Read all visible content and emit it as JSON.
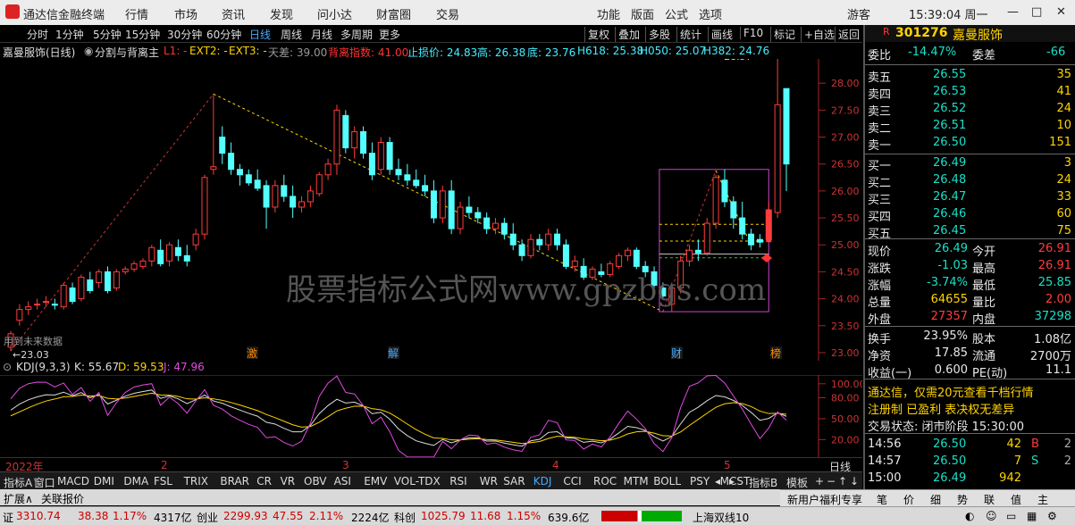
{
  "app": {
    "title": "通达信金融终端"
  },
  "menu": [
    "行情",
    "市场",
    "资讯",
    "发现",
    "问小达",
    "财富圈",
    "交易"
  ],
  "top_right": {
    "items": [
      "功能",
      "版面",
      "公式",
      "选项"
    ],
    "user": "游客",
    "time": "15:39:04 周一"
  },
  "toolbar": {
    "periods": [
      "分时",
      "1分钟",
      "5分钟",
      "15分钟",
      "30分钟",
      "60分钟",
      "日线",
      "周线",
      "月线",
      "多周期",
      "更多"
    ],
    "active_period": "日线",
    "buttons": [
      "复权",
      "叠加",
      "多股",
      "统计",
      "画线",
      "F10",
      "标记",
      "+自选",
      "返回"
    ]
  },
  "info": {
    "stock": "嘉曼服饰(日线)",
    "formula": "分割与背离主",
    "L1": "L1: -",
    "EXT2": "EXT2: -",
    "EXT3": "EXT3: -",
    "tiancha": "天差: 39.00",
    "beili": "背离指数: 41.00",
    "stop": "止损价: 24.83",
    "high": "高: 26.38",
    "low": "底: 23.76",
    "h618": "H618: 25.38",
    "h050": "H050: 25.07",
    "h382": "H382: 24.76"
  },
  "chart_data": {
    "type": "candlestick",
    "y_ticks": [
      "28.00",
      "27.50",
      "27.00",
      "26.50",
      "26.00",
      "25.50",
      "25.00",
      "24.50",
      "24.00",
      "23.50",
      "23.00"
    ],
    "ylim": [
      22.85,
      28.45
    ],
    "max_label": "28.57",
    "min_label": "23.03",
    "future_note": "用到未来数据",
    "watermark": "股票指标公式网www.gpzbgs.com",
    "markers": [
      "激",
      "解",
      "财",
      "榜"
    ],
    "candles": [
      [
        23.1,
        23.4,
        23.03,
        23.35
      ],
      [
        23.6,
        23.9,
        23.5,
        23.8
      ],
      [
        23.8,
        23.95,
        23.7,
        23.85
      ],
      [
        23.9,
        24,
        23.8,
        23.9
      ],
      [
        23.95,
        24.05,
        23.85,
        23.95
      ],
      [
        23.9,
        24,
        23.8,
        23.88
      ],
      [
        23.85,
        24.3,
        23.8,
        24.25
      ],
      [
        24.2,
        24.3,
        23.9,
        23.95
      ],
      [
        24,
        24.45,
        23.95,
        24.4
      ],
      [
        24.35,
        24.5,
        24.1,
        24.15
      ],
      [
        24.3,
        24.55,
        24.2,
        24.5
      ],
      [
        24.5,
        24.6,
        24.1,
        24.15
      ],
      [
        24.2,
        24.55,
        24.15,
        24.5
      ],
      [
        24.5,
        24.6,
        24.45,
        24.55
      ],
      [
        24.55,
        24.7,
        24.5,
        24.65
      ],
      [
        24.6,
        24.75,
        24.55,
        24.7
      ],
      [
        24.7,
        25,
        24.6,
        24.95
      ],
      [
        24.9,
        25.1,
        24.6,
        24.65
      ],
      [
        24.7,
        25.05,
        24.6,
        25
      ],
      [
        24.95,
        25.1,
        24.7,
        24.8
      ],
      [
        24.8,
        25,
        24.6,
        24.7
      ],
      [
        25,
        25.3,
        24.9,
        25.2
      ],
      [
        25.2,
        26.3,
        25.1,
        26.25
      ],
      [
        26.4,
        27.8,
        26.3,
        26.45
      ],
      [
        27,
        27.2,
        26.5,
        26.7
      ],
      [
        26.7,
        26.9,
        26.3,
        26.4
      ],
      [
        26.4,
        26.5,
        26.1,
        26.3
      ],
      [
        26.3,
        26.4,
        26.1,
        26.15
      ],
      [
        26.2,
        26.4,
        26,
        26.05
      ],
      [
        26.1,
        26.2,
        25.3,
        25.7
      ],
      [
        25.7,
        26.2,
        25.6,
        26.1
      ],
      [
        26.1,
        26.3,
        25.8,
        25.9
      ],
      [
        25.9,
        26.1,
        25.5,
        25.7
      ],
      [
        25.7,
        25.9,
        25.6,
        25.8
      ],
      [
        25.8,
        26.1,
        25.7,
        26
      ],
      [
        25.95,
        26.35,
        25.9,
        26.3
      ],
      [
        26.3,
        26.6,
        26.2,
        26.5
      ],
      [
        26.5,
        27.6,
        26.3,
        27.5
      ],
      [
        27.4,
        27.5,
        26.7,
        26.8
      ],
      [
        26.8,
        27.2,
        26.6,
        27.1
      ],
      [
        27.1,
        27.2,
        26.6,
        26.7
      ],
      [
        26.7,
        26.9,
        26.2,
        26.3
      ],
      [
        26.4,
        27,
        26.3,
        26.9
      ],
      [
        26.9,
        27,
        26.3,
        26.4
      ],
      [
        26.4,
        26.6,
        26.2,
        26.3
      ],
      [
        26.3,
        26.5,
        26.1,
        26.2
      ],
      [
        26.2,
        26.4,
        26.05,
        26.1
      ],
      [
        26.1,
        26.3,
        25.9,
        26
      ],
      [
        26,
        26.2,
        25.4,
        25.5
      ],
      [
        25.5,
        26.1,
        25.4,
        26
      ],
      [
        26,
        26.2,
        25.2,
        25.3
      ],
      [
        25.3,
        25.8,
        25.2,
        25.7
      ],
      [
        25.7,
        25.9,
        25.5,
        25.6
      ],
      [
        25.6,
        25.7,
        25.4,
        25.5
      ],
      [
        25.5,
        25.6,
        25.2,
        25.3
      ],
      [
        25.3,
        25.5,
        25.2,
        25.4
      ],
      [
        25.4,
        25.5,
        25.1,
        25.2
      ],
      [
        25.2,
        25.4,
        24.9,
        25
      ],
      [
        25,
        25.1,
        24.7,
        24.8
      ],
      [
        24.8,
        25.2,
        24.75,
        25.1
      ],
      [
        25.1,
        25.2,
        24.9,
        25
      ],
      [
        25,
        25.3,
        24.9,
        25.2
      ],
      [
        25.2,
        25.3,
        24.9,
        25
      ],
      [
        25,
        25.1,
        24.55,
        24.6
      ],
      [
        24.6,
        24.8,
        24.5,
        24.7
      ],
      [
        24.6,
        24.75,
        24.35,
        24.4
      ],
      [
        24.4,
        24.6,
        24.35,
        24.55
      ],
      [
        24.5,
        24.65,
        24.4,
        24.45
      ],
      [
        24.45,
        24.7,
        24.4,
        24.65
      ],
      [
        24.6,
        24.85,
        24.55,
        24.8
      ],
      [
        24.8,
        24.95,
        24.7,
        24.9
      ],
      [
        24.9,
        24.95,
        24.55,
        24.6
      ],
      [
        24.6,
        24.7,
        24.4,
        24.5
      ],
      [
        24.5,
        24.6,
        24.2,
        24.25
      ],
      [
        24.2,
        24.3,
        24,
        24.05
      ],
      [
        23.9,
        24.3,
        23.76,
        24.2
      ],
      [
        24.2,
        24.8,
        24.1,
        24.7
      ],
      [
        24.7,
        25,
        24.6,
        24.9
      ],
      [
        24.9,
        25.1,
        24.7,
        24.85
      ],
      [
        24.85,
        25.5,
        24.8,
        25.4
      ],
      [
        25.4,
        26.3,
        25.3,
        26.25
      ],
      [
        26.2,
        26.4,
        25.7,
        25.8
      ],
      [
        25.8,
        25.9,
        25.3,
        25.5
      ],
      [
        25.5,
        25.8,
        25.1,
        25.2
      ],
      [
        25.2,
        25.3,
        24.9,
        25
      ],
      [
        25.1,
        25.2,
        24.95,
        25.05
      ],
      [
        25.1,
        25.8,
        25.05,
        25.65
      ],
      [
        25.6,
        28.57,
        25.5,
        27.6
      ],
      [
        27.9,
        27.9,
        26,
        26.5
      ]
    ]
  },
  "kdj": {
    "label": "KDJ(9,3,3)",
    "K": "K: 55.67",
    "D": "D: 59.53",
    "J": "J: 47.96",
    "ticks": [
      "100.00",
      "80.00",
      "50.00",
      "20.00"
    ]
  },
  "dates": [
    "2022年",
    "2",
    "3",
    "4",
    "5"
  ],
  "axis_label": "日线",
  "indicators": [
    "指标A",
    "窗口",
    "MACD",
    "DMI",
    "DMA",
    "FSL",
    "TRIX",
    "BRAR",
    "CR",
    "VR",
    "OBV",
    "ASI",
    "EMV",
    "VOL-TDX",
    "RSI",
    "WR",
    "SAR",
    "KDJ",
    "CCI",
    "ROC",
    "MTM",
    "BOLL",
    "PSY",
    "MCST"
  ],
  "ind_right": [
    "指标B",
    "模板"
  ],
  "ext": [
    "扩展∧",
    "关联报价"
  ],
  "side": {
    "code": "301276",
    "name": "嘉曼服饰",
    "weibi": "委比",
    "weibi_v": "-14.47%",
    "weicha": "委差",
    "weicha_v": "-66",
    "asks": [
      [
        "卖五",
        "26.55",
        "35"
      ],
      [
        "卖四",
        "26.53",
        "41"
      ],
      [
        "卖三",
        "26.52",
        "24"
      ],
      [
        "卖二",
        "26.51",
        "10"
      ],
      [
        "卖一",
        "26.50",
        "151"
      ]
    ],
    "bids": [
      [
        "买一",
        "26.49",
        "3"
      ],
      [
        "买二",
        "26.48",
        "24"
      ],
      [
        "买三",
        "26.47",
        "33"
      ],
      [
        "买四",
        "26.46",
        "60"
      ],
      [
        "买五",
        "26.45",
        "75"
      ]
    ],
    "quote": [
      [
        "现价",
        "26.49",
        "今开",
        "26.91"
      ],
      [
        "涨跌",
        "-1.03",
        "最高",
        "26.91"
      ],
      [
        "涨幅",
        "-3.74%",
        "最低",
        "25.85"
      ],
      [
        "总量",
        "64655",
        "量比",
        "2.00"
      ],
      [
        "外盘",
        "27357",
        "内盘",
        "37298"
      ]
    ],
    "fund": [
      [
        "换手",
        "23.95%",
        "股本",
        "1.08亿"
      ],
      [
        "净资",
        "17.85",
        "流通",
        "2700万"
      ],
      [
        "收益(一)",
        "0.600",
        "PE(动)",
        "11.1"
      ]
    ],
    "ad1": "通达信，仅需20元查看千档行情",
    "ad2": "注册制 已盈利 表决权无差异",
    "status": "交易状态: 闭市阶段 15:30:00",
    "ticks": [
      [
        "14:56",
        "26.50",
        "42",
        "B",
        "2"
      ],
      [
        "14:57",
        "26.50",
        "7",
        "S",
        "2"
      ],
      [
        "15:00",
        "26.49",
        "942",
        "",
        ""
      ]
    ]
  },
  "statusbar": {
    "sh_label": "证",
    "sh": "3310.74",
    "sh_chg": "38.38",
    "sh_pct": "1.17%",
    "sh_amt": "4317亿",
    "cy_label": "创业",
    "cy": "2299.93",
    "cy_chg": "47.55",
    "cy_pct": "2.11%",
    "cy_amt": "2224亿",
    "kc_label": "科创",
    "kc": "1025.79",
    "kc_chg": "11.68",
    "kc_pct": "1.15%",
    "kc_amt": "639.6亿",
    "ticker": "上海双线10",
    "welfare": "新用户福利专享",
    "tabs": [
      "笔",
      "价",
      "细",
      "势",
      "联",
      "值",
      "主"
    ]
  }
}
